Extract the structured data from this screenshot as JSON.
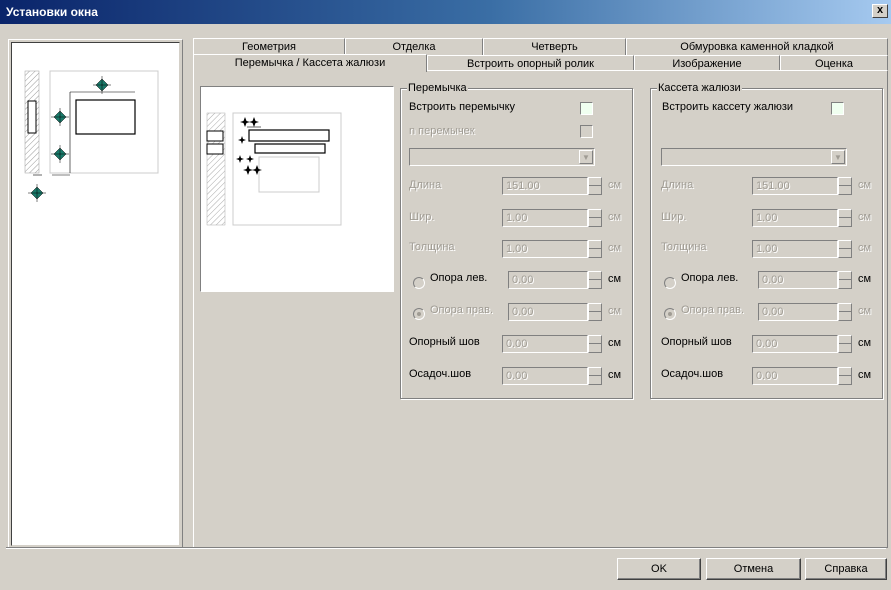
{
  "window": {
    "title": "Установки окна",
    "close_label": "x"
  },
  "tabs_row1": [
    "Геометрия",
    "Отделка",
    "Четверть",
    "Обмуровка каменной кладкой"
  ],
  "tabs_row2": [
    "Перемычка / Кассета жалюзи",
    "Встроить опорный ролик",
    "Изображение",
    "Оценка"
  ],
  "active_tab": "Перемычка / Кассета жалюзи",
  "lintel_group": {
    "title": "Перемычка",
    "embed_label": "Встроить перемычку",
    "n_label": "n перемычек",
    "length_label": "Длина",
    "length_value": "151.00",
    "length_unit": "см",
    "width_label": "Шир.",
    "width_value": "1.00",
    "width_unit": "см",
    "thickness_label": "Толщина",
    "thickness_value": "1.00",
    "thickness_unit": "см",
    "support_left_label": "Опора лев.",
    "support_left_value": "0.00",
    "support_left_unit": "см",
    "support_right_label": "Опора прав.",
    "support_right_value": "0.00",
    "support_right_unit": "см",
    "support_joint_label": "Опорный шов",
    "support_joint_value": "0.00",
    "support_joint_unit": "см",
    "settle_joint_label": "Осадоч.шов",
    "settle_joint_value": "0.00",
    "settle_joint_unit": "см"
  },
  "blind_group": {
    "title": "Кассета жалюзи",
    "embed_label": "Встроить кассету жалюзи",
    "length_label": "Длина",
    "length_value": "151.00",
    "length_unit": "см",
    "width_label": "Шир.",
    "width_value": "1.00",
    "width_unit": "см",
    "thickness_label": "Толщина",
    "thickness_value": "1.00",
    "thickness_unit": "см",
    "support_left_label": "Опора лев.",
    "support_left_value": "0.00",
    "support_left_unit": "см",
    "support_right_label": "Опора прав.",
    "support_right_value": "0.00",
    "support_right_unit": "см",
    "support_joint_label": "Опорный шов",
    "support_joint_value": "0.00",
    "support_joint_unit": "см",
    "settle_joint_label": "Осадоч.шов",
    "settle_joint_value": "0.00",
    "settle_joint_unit": "см"
  },
  "buttons": {
    "ok": "OK",
    "cancel": "Отмена",
    "help": "Справка"
  },
  "colors": {
    "title_gradient_start": "#0a246a",
    "title_gradient_end": "#a6caf0",
    "face": "#d4d0c8",
    "marker": "#1a7a6a",
    "checkbox_fill": "#f0fff0"
  }
}
